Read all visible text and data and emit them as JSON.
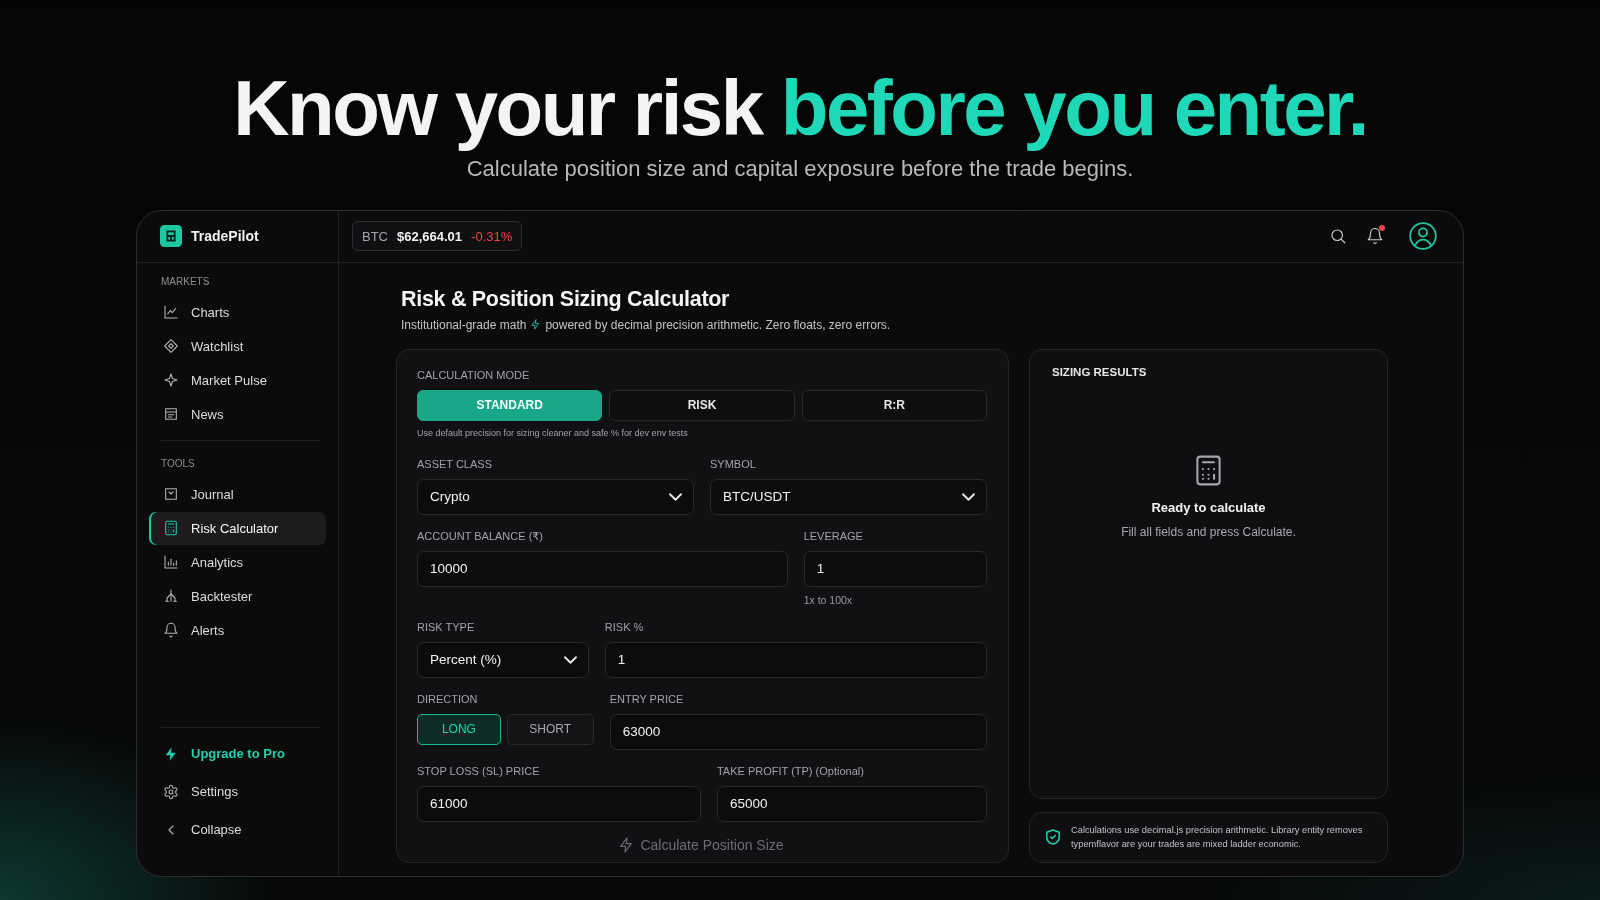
{
  "headline": {
    "text": "Know your risk",
    "highlight": "before you enter."
  },
  "tagline": "Calculate position size and capital exposure before the trade begins.",
  "app": {
    "brand": "TradePilot",
    "ticker": {
      "symbol": "BTC",
      "price": "$62,664.01",
      "change": "-0.31%",
      "negative": true
    },
    "notifications": {
      "unread": true
    },
    "sidebar": {
      "sections": [
        {
          "heading": "MARKETS",
          "items": [
            {
              "label": "Charts",
              "selected": false
            },
            {
              "label": "Watchlist",
              "selected": false
            },
            {
              "label": "Market Pulse",
              "selected": false
            },
            {
              "label": "News",
              "selected": false
            }
          ]
        },
        {
          "heading": "TOOLS",
          "items": [
            {
              "label": "Journal",
              "selected": false
            },
            {
              "label": "Risk Calculator",
              "selected": true
            },
            {
              "label": "Analytics",
              "selected": false
            },
            {
              "label": "Backtester",
              "selected": false
            },
            {
              "label": "Alerts",
              "selected": false
            }
          ]
        }
      ],
      "footer": [
        {
          "label": "Upgrade to Pro",
          "kind": "upgrade"
        },
        {
          "label": "Settings",
          "kind": "link"
        },
        {
          "label": "Collapse",
          "kind": "link"
        }
      ]
    },
    "page": {
      "title": "Risk & Position Sizing Calculator",
      "subtitle_lead": "Institutional-grade math",
      "subtitle_rest": "powered by decimal precision arithmetic. Zero floats, zero errors."
    },
    "calculator": {
      "mode": {
        "label": "CALCULATION MODE",
        "options": [
          {
            "label": "STANDARD",
            "selected": true
          },
          {
            "label": "RISK",
            "selected": false
          },
          {
            "label": "R:R",
            "selected": false
          }
        ],
        "hint": "Use default precision for sizing cleaner and safe % for dev env tests"
      },
      "rows": [
        {
          "fields": [
            {
              "label": "ASSET CLASS",
              "kind": "select",
              "value": "Crypto"
            },
            {
              "label": "SYMBOL",
              "kind": "select",
              "value": "BTC/USDT"
            }
          ]
        },
        {
          "fields": [
            {
              "label": "ACCOUNT BALANCE (₹)",
              "kind": "input",
              "value": "10000"
            },
            {
              "label": "LEVERAGE",
              "kind": "input",
              "value": "1",
              "hint": "1x to 100x"
            }
          ]
        },
        {
          "fields": [
            {
              "label": "RISK TYPE",
              "kind": "select",
              "value": "Percent (%)"
            },
            {
              "label": "RISK %",
              "kind": "input",
              "value": "1"
            }
          ]
        },
        {
          "fields": [
            {
              "label": "DIRECTION",
              "kind": "toggle",
              "options": [
                {
                  "label": "LONG",
                  "selected": true
                },
                {
                  "label": "SHORT",
                  "selected": false
                }
              ]
            },
            {
              "label": "ENTRY PRICE",
              "kind": "input",
              "value": "63000"
            }
          ]
        },
        {
          "fields": [
            {
              "label": "STOP LOSS (SL) PRICE",
              "kind": "input",
              "value": "61000"
            },
            {
              "label": "TAKE PROFIT (TP) (Optional)",
              "kind": "input",
              "value": "65000"
            }
          ]
        }
      ],
      "submit": {
        "label": "Calculate Position Size",
        "disabled": true
      }
    },
    "results": {
      "heading": "SIZING RESULTS",
      "empty_title": "Ready to calculate",
      "empty_text": "Fill all fields and press Calculate."
    },
    "note": "Calculations use decimal.js precision arithmetic. Library entity removes typemflavor are your trades are mixed ladder economic."
  }
}
